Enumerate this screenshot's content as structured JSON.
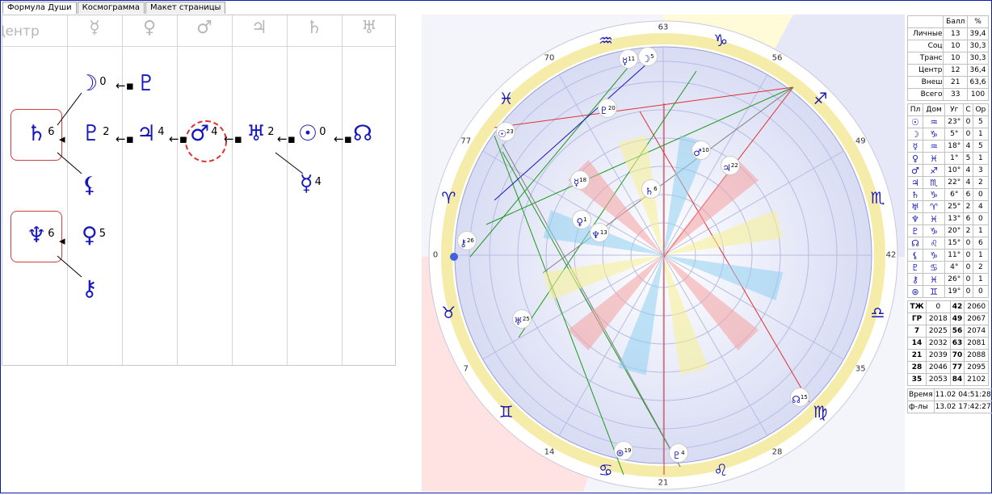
{
  "tabs": [
    {
      "label": "Формула Души"
    },
    {
      "label": "Космограмма"
    },
    {
      "label": "Макет страницы"
    }
  ],
  "grid": {
    "headers": [
      {
        "label": "Центр"
      },
      {
        "label": "☿"
      },
      {
        "label": "♀"
      },
      {
        "label": "♂"
      },
      {
        "label": "♃"
      },
      {
        "label": "♄"
      },
      {
        "label": "♅"
      }
    ],
    "nodes": [
      {
        "glyph": "☽",
        "num": "0"
      },
      {
        "glyph": "♇",
        "num": ""
      },
      {
        "glyph": "♄",
        "num": "6"
      },
      {
        "glyph": "♇",
        "num": "2"
      },
      {
        "glyph": "♃",
        "num": "4"
      },
      {
        "glyph": "♂",
        "num": "4"
      },
      {
        "glyph": "♅",
        "num": "2"
      },
      {
        "glyph": "☉",
        "num": "0"
      },
      {
        "glyph": "☊",
        "num": ""
      },
      {
        "glyph": "⚸",
        "num": ""
      },
      {
        "glyph": "☿",
        "num": "4"
      },
      {
        "glyph": "♆",
        "num": "6"
      },
      {
        "glyph": "♀",
        "num": "5"
      },
      {
        "glyph": "⚷",
        "num": ""
      }
    ]
  },
  "chart": {
    "degrees": [
      "63",
      "56",
      "49",
      "42",
      "35",
      "28",
      "21",
      "14",
      "7",
      "0",
      "77",
      "70"
    ],
    "signs": [
      "♑",
      "♐",
      "♏",
      "♎",
      "♍",
      "♌",
      "♋",
      "♊",
      "♉",
      "♈",
      "♓",
      "♒"
    ],
    "planets": [
      {
        "g": "☽",
        "n": "5"
      },
      {
        "g": "☿",
        "n": "11"
      },
      {
        "g": "♇",
        "n": "20"
      },
      {
        "g": "☉",
        "n": "23"
      },
      {
        "g": "♂",
        "n": "10"
      },
      {
        "g": "♃",
        "n": "22"
      },
      {
        "g": "☿",
        "n": "18"
      },
      {
        "g": "♄",
        "n": "6"
      },
      {
        "g": "♀",
        "n": "1"
      },
      {
        "g": "♆",
        "n": "13"
      },
      {
        "g": "⚷",
        "n": "26"
      },
      {
        "g": "♅",
        "n": "25"
      },
      {
        "g": "☊",
        "n": "15"
      },
      {
        "g": "⊛",
        "n": "19"
      },
      {
        "g": "♇",
        "n": "4"
      }
    ],
    "rays": [
      "1",
      "2",
      "3",
      "4",
      "5",
      "6"
    ],
    "colors": {
      "blue": "#1818b8",
      "red": "#e03030",
      "green": "#1a9a1a"
    }
  },
  "scores": {
    "header": [
      "",
      "Балл",
      "%"
    ],
    "rows": [
      [
        "Личные",
        "13",
        "39,4"
      ],
      [
        "Соц",
        "10",
        "30,3"
      ],
      [
        "Транс",
        "10",
        "30,3"
      ],
      [
        "Центр",
        "12",
        "36,4"
      ],
      [
        "Внеш",
        "21",
        "63,6"
      ],
      [
        "Всего",
        "33",
        "100"
      ]
    ]
  },
  "planet_table": {
    "header": [
      "Пл",
      "Дом",
      "Уг",
      "С",
      "Ор"
    ],
    "rows": [
      [
        "☉",
        "♒",
        "23°",
        "0",
        "5"
      ],
      [
        "☽",
        "♑",
        "5°",
        "0",
        "1"
      ],
      [
        "☿",
        "♒",
        "18°",
        "4",
        "5"
      ],
      [
        "♀",
        "♓",
        "1°",
        "5",
        "1"
      ],
      [
        "♂",
        "♐",
        "10°",
        "4",
        "3"
      ],
      [
        "♃",
        "♏",
        "22°",
        "4",
        "2"
      ],
      [
        "♄",
        "♑",
        "6°",
        "6",
        "0"
      ],
      [
        "♅",
        "♈",
        "25°",
        "2",
        "4"
      ],
      [
        "♆",
        "♓",
        "13°",
        "6",
        "0"
      ],
      [
        "♇",
        "♑",
        "20°",
        "2",
        "1"
      ],
      [
        "☊",
        "♌",
        "15°",
        "0",
        "6"
      ],
      [
        "⚸",
        "♑",
        "11°",
        "0",
        "1"
      ],
      [
        "♇",
        "♋",
        "4°",
        "0",
        "2"
      ],
      [
        "⚷",
        "♓",
        "26°",
        "0",
        "1"
      ],
      [
        "⊛",
        "♊",
        "19°",
        "0",
        "0"
      ]
    ]
  },
  "years": {
    "rows": [
      [
        "ТЖ",
        "0",
        "42",
        "2060"
      ],
      [
        "ГР",
        "2018",
        "49",
        "2067"
      ],
      [
        "7",
        "2025",
        "56",
        "2074"
      ],
      [
        "14",
        "2032",
        "63",
        "2081"
      ],
      [
        "21",
        "2039",
        "70",
        "2088"
      ],
      [
        "28",
        "2046",
        "77",
        "2095"
      ],
      [
        "35",
        "2053",
        "84",
        "2102"
      ]
    ]
  },
  "timestamps": [
    {
      "label": "Время",
      "value": "11.02 04:51:28"
    },
    {
      "label": "ф-лы",
      "value": "13.02 17:42:27"
    }
  ]
}
